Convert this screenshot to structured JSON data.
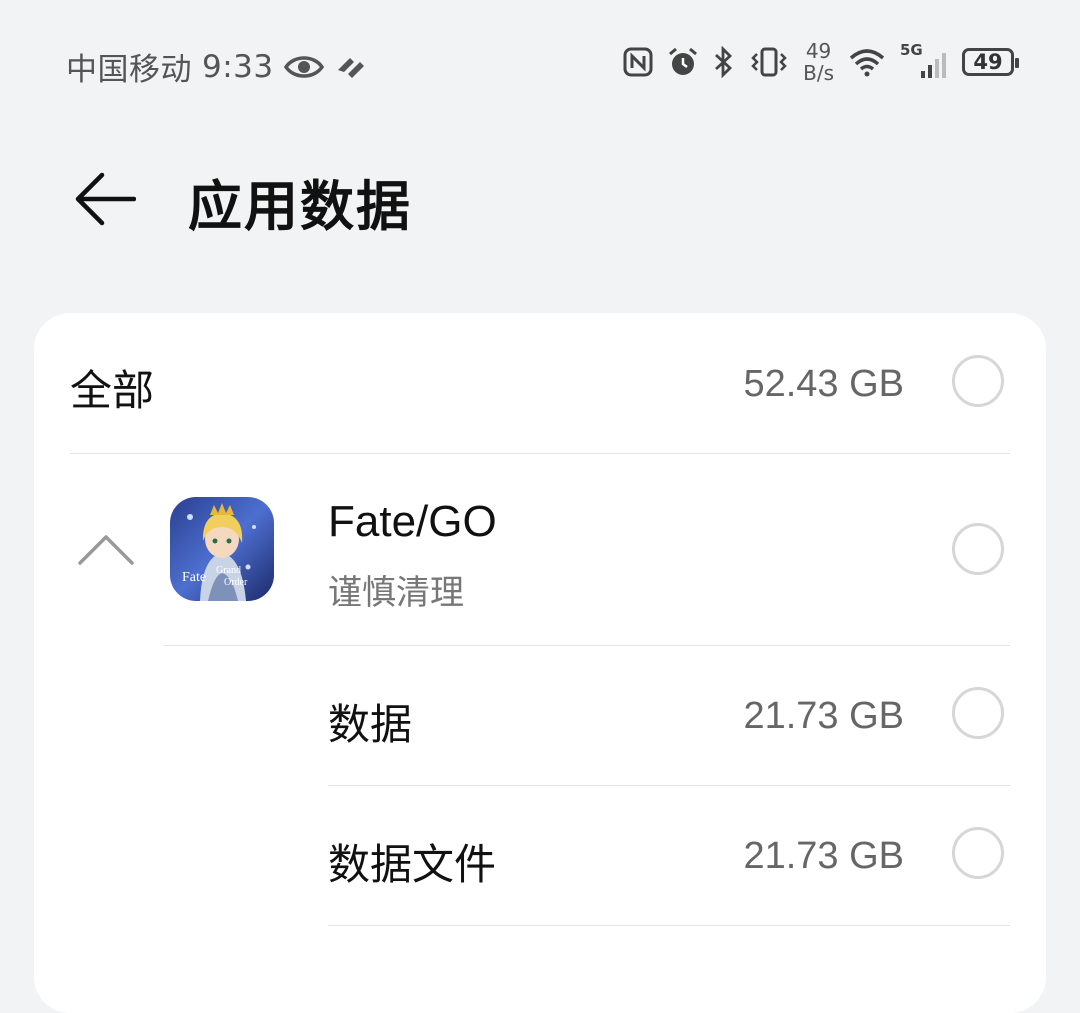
{
  "status_bar": {
    "carrier": "中国移动",
    "time": "9:33",
    "net_speed_value": "49",
    "net_speed_unit": "B/s",
    "network_type": "5G",
    "battery": "49",
    "icons": [
      "eye-icon",
      "hd-call-icon",
      "nfc-icon",
      "alarm-icon",
      "bluetooth-icon",
      "vibrate-icon",
      "wifi-icon",
      "signal-icon",
      "battery-icon"
    ]
  },
  "header": {
    "title": "应用数据",
    "back_icon": "back-arrow-icon"
  },
  "list": {
    "all": {
      "label": "全部",
      "size": "52.43 GB"
    },
    "app": {
      "name": "Fate/GO",
      "subtitle": "谨慎清理",
      "icon_text_1": "Fate",
      "icon_text_2": "Grand",
      "icon_text_3": "Order"
    },
    "items": [
      {
        "label": "数据",
        "size": "21.73 GB"
      },
      {
        "label": "数据文件",
        "size": "21.73 GB"
      }
    ]
  },
  "colors": {
    "background": "#f1f3f5",
    "card": "#ffffff",
    "secondary_text": "#666666",
    "radio_border": "#d6d6d6"
  }
}
